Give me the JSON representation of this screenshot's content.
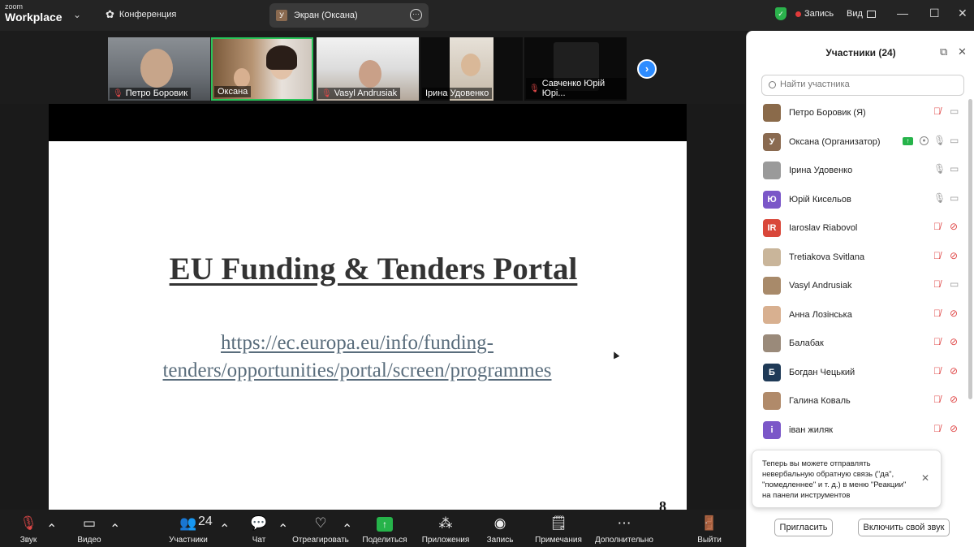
{
  "app": {
    "brand_small": "zoom",
    "brand_big": "Workplace"
  },
  "topbar": {
    "conference_label": "Конференция",
    "screen_tab_avatar": "У",
    "screen_tab_label": "Экран (Оксана)",
    "record_label": "Запись",
    "view_label": "Вид"
  },
  "thumbnails": [
    {
      "name": "Петро Боровик",
      "muted": true
    },
    {
      "name": "Оксана",
      "muted": false,
      "active": true
    },
    {
      "name": "Vasyl Andrusiak",
      "muted": true
    },
    {
      "name": "Ірина Удовенко",
      "muted": false
    },
    {
      "name": "Савченко Юрій Юрі...",
      "muted": true
    }
  ],
  "slide": {
    "title": "EU Funding & Tenders Portal",
    "link_line1": "https://ec.europa.eu/info/funding-",
    "link_line2": "tenders/opportunities/portal/screen/programmes",
    "page_number": "8"
  },
  "toolbar": {
    "audio": "Звук",
    "video": "Видео",
    "participants": "Участники",
    "participants_count": "24",
    "chat": "Чат",
    "react": "Отреагировать",
    "share": "Поделиться",
    "apps": "Приложения",
    "record": "Запись",
    "notes": "Примечания",
    "more": "Дополнительно",
    "leave": "Выйти"
  },
  "panel": {
    "title": "Участники (24)",
    "search_placeholder": "Найти участника",
    "participants": [
      {
        "name": "Петро Боровик (Я)",
        "avatar": "",
        "avatar_color": "#8a6a4a",
        "mic": "off",
        "cam": "on"
      },
      {
        "name": "Оксана (Организатор)",
        "avatar": "У",
        "avatar_color": "#8a6a50",
        "mic": "on",
        "cam": "on",
        "sharing": true,
        "recording": true
      },
      {
        "name": "Ірина Удовенко",
        "avatar": "",
        "avatar_color": "#9a9a9a",
        "mic": "on",
        "cam": "on"
      },
      {
        "name": "Юрій Кисельов",
        "avatar": "Ю",
        "avatar_color": "#7b57c8",
        "mic": "on",
        "cam": "on"
      },
      {
        "name": "Iaroslav Riabovol",
        "avatar": "IR",
        "avatar_color": "#d9473a",
        "mic": "off",
        "cam": "off"
      },
      {
        "name": "Tretiakova Svitlana",
        "avatar": "",
        "avatar_color": "#c9b59a",
        "mic": "off",
        "cam": "off"
      },
      {
        "name": "Vasyl Andrusiak",
        "avatar": "",
        "avatar_color": "#a88a6a",
        "mic": "off",
        "cam": "on"
      },
      {
        "name": "Анна Лозінська",
        "avatar": "",
        "avatar_color": "#d8b090",
        "mic": "off",
        "cam": "off"
      },
      {
        "name": "Балабак",
        "avatar": "",
        "avatar_color": "#9a8a7a",
        "mic": "off",
        "cam": "off"
      },
      {
        "name": "Богдан Чецький",
        "avatar": "Б",
        "avatar_color": "#1f3a57",
        "mic": "off",
        "cam": "off"
      },
      {
        "name": "Галина  Коваль",
        "avatar": "",
        "avatar_color": "#b08a6a",
        "mic": "off",
        "cam": "off"
      },
      {
        "name": "іван жиляк",
        "avatar": "і",
        "avatar_color": "#7b57c8",
        "mic": "off",
        "cam": "off"
      }
    ],
    "toast_text": "Теперь вы можете отправлять невербальную обратную связь (\"да\", \"помедленнее\" и т. д.) в меню \"Реакции\" на панели инструментов",
    "invite_button": "Пригласить",
    "unmute_button": "Включить свой звук"
  }
}
